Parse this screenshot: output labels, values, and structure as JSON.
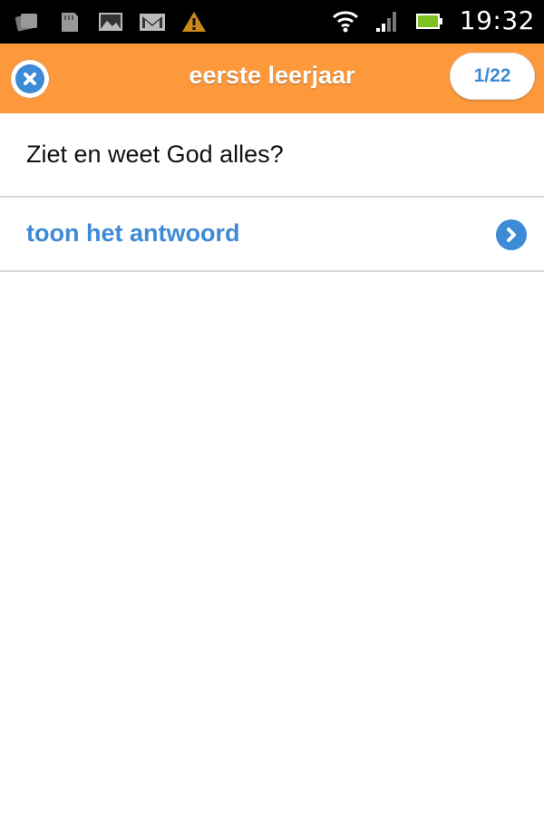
{
  "status_bar": {
    "time": "19:32",
    "icons": [
      "photos-icon",
      "sd-card-icon",
      "image-icon",
      "gmail-icon",
      "warning-icon",
      "wifi-icon",
      "signal-icon",
      "battery-icon"
    ]
  },
  "header": {
    "title": "eerste leerjaar",
    "counter": "1/22",
    "close_icon": "close-icon"
  },
  "question": {
    "text": "Ziet en weet God alles?"
  },
  "answer": {
    "label": "toon het antwoord",
    "icon": "chevron-right-icon"
  },
  "colors": {
    "header": "#fd993b",
    "accent": "#3d8ad6",
    "divider": "#d9d9d9"
  }
}
